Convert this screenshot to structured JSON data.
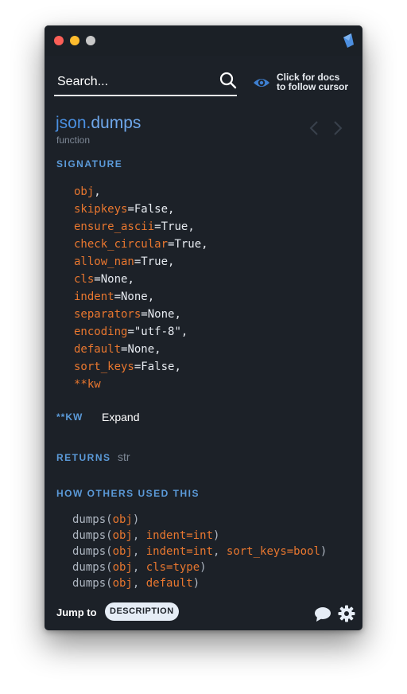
{
  "search": {
    "placeholder": "Search..."
  },
  "follow": {
    "line1": "Click for docs",
    "line2": "to follow cursor"
  },
  "doc": {
    "module": "json.",
    "name": "dumps",
    "kind": "function"
  },
  "signature": {
    "label": "SIGNATURE",
    "params": [
      {
        "name": "obj",
        "value": "",
        "suffix": ","
      },
      {
        "name": "skipkeys",
        "value": "=False",
        "suffix": ","
      },
      {
        "name": "ensure_ascii",
        "value": "=True",
        "suffix": ","
      },
      {
        "name": "check_circular",
        "value": "=True",
        "suffix": ","
      },
      {
        "name": "allow_nan",
        "value": "=True",
        "suffix": ","
      },
      {
        "name": "cls",
        "value": "=None",
        "suffix": ","
      },
      {
        "name": "indent",
        "value": "=None",
        "suffix": ","
      },
      {
        "name": "separators",
        "value": "=None",
        "suffix": ","
      },
      {
        "name": "encoding",
        "value": "=\"utf-8\"",
        "suffix": ","
      },
      {
        "name": "default",
        "value": "=None",
        "suffix": ","
      },
      {
        "name": "sort_keys",
        "value": "=False",
        "suffix": ","
      },
      {
        "name": "**kw",
        "value": "",
        "suffix": ""
      }
    ]
  },
  "kw": {
    "label": "**KW",
    "expand": "Expand"
  },
  "returns": {
    "label": "RETURNS",
    "type": "str"
  },
  "usage": {
    "label": "HOW OTHERS USED THIS",
    "lines": [
      [
        {
          "t": "dumps(",
          "p": false
        },
        {
          "t": "obj",
          "p": true
        },
        {
          "t": ")",
          "p": false
        }
      ],
      [
        {
          "t": "dumps(",
          "p": false
        },
        {
          "t": "obj",
          "p": true
        },
        {
          "t": ", ",
          "p": false
        },
        {
          "t": "indent=int",
          "p": true
        },
        {
          "t": ")",
          "p": false
        }
      ],
      [
        {
          "t": "dumps(",
          "p": false
        },
        {
          "t": "obj",
          "p": true
        },
        {
          "t": ", ",
          "p": false
        },
        {
          "t": "indent=int",
          "p": true
        },
        {
          "t": ", ",
          "p": false
        },
        {
          "t": "sort_keys=bool",
          "p": true
        },
        {
          "t": ")",
          "p": false
        }
      ],
      [
        {
          "t": "dumps(",
          "p": false
        },
        {
          "t": "obj",
          "p": true
        },
        {
          "t": ", ",
          "p": false
        },
        {
          "t": "cls=type",
          "p": true
        },
        {
          "t": ")",
          "p": false
        }
      ],
      [
        {
          "t": "dumps(",
          "p": false
        },
        {
          "t": "obj",
          "p": true
        },
        {
          "t": ", ",
          "p": false
        },
        {
          "t": "default",
          "p": true
        },
        {
          "t": ")",
          "p": false
        }
      ]
    ]
  },
  "footer": {
    "jump_label": "Jump to",
    "description_button": "DESCRIPTION"
  },
  "colors": {
    "accent": "#4a90e2",
    "param": "#e9772f",
    "background": "#1c2128"
  },
  "icons": [
    "kite-logo-icon",
    "search-icon",
    "eye-icon",
    "back-arrow-icon",
    "forward-arrow-icon",
    "chat-icon",
    "gear-icon"
  ]
}
